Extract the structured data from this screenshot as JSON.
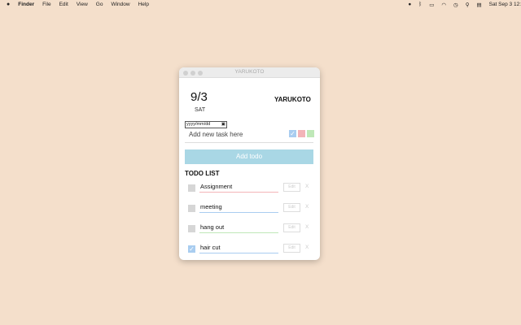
{
  "menubar": {
    "apple": "",
    "app": "Finder",
    "items": [
      "File",
      "Edit",
      "View",
      "Go",
      "Window",
      "Help"
    ],
    "clock": "Sat Sep 3  12:"
  },
  "window": {
    "title": "YARUKOTO"
  },
  "header": {
    "date": "9/3",
    "weekday": "SAT",
    "brand": "YARUKOTO"
  },
  "form": {
    "date_placeholder": "yyyy/mm/dd",
    "task_placeholder": "Add new task here",
    "add_label": "Add todo",
    "colors": [
      "#a9cdf0",
      "#f3b4b8",
      "#bfe8b8"
    ]
  },
  "list": {
    "heading": "TODO LIST",
    "edit_label": "Edit",
    "delete_label": "X",
    "items": [
      {
        "name": "Assignment",
        "done": false,
        "color": "#f3b4b8"
      },
      {
        "name": "meeting",
        "done": false,
        "color": "#a9cdf0"
      },
      {
        "name": "hang out",
        "done": false,
        "color": "#bfe8b8"
      },
      {
        "name": "hair cut",
        "done": true,
        "color": "#a9cdf0"
      }
    ]
  }
}
